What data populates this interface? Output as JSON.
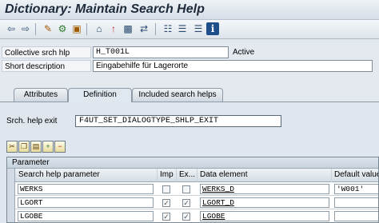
{
  "title": "Dictionary: Maintain Search Help",
  "toolbar": {
    "icons": [
      "back-icon",
      "forward-icon",
      "edit-icon",
      "activate-icon",
      "object-list-icon",
      "where-used-icon",
      "check-icon",
      "navigate-icon",
      "hierarchy-icon",
      "display-icon",
      "list-icon",
      "info-icon"
    ],
    "glyphs": [
      "⇦",
      "⇨",
      "✎",
      "⚙",
      "▣",
      "⌂",
      "↑",
      "▩",
      "⇄",
      "☷",
      "☰",
      "i"
    ]
  },
  "header": {
    "collective_label": "Collective srch hlp",
    "collective_value": "H_T001L",
    "status": "Active",
    "short_desc_label": "Short description",
    "short_desc_value": "Eingabehilfe für Lagerorte"
  },
  "tabs": [
    "Attributes",
    "Definition",
    "Included search helps"
  ],
  "active_tab": "Definition",
  "definition": {
    "exit_label": "Srch. help exit",
    "exit_value": "F4UT_SET_DIALOGTYPE_SHLP_EXIT"
  },
  "grid_buttons": [
    "cut-icon",
    "copy-icon",
    "paste-icon",
    "insert-row-icon",
    "delete-row-icon"
  ],
  "grid": {
    "title": "Parameter",
    "columns": [
      "Search help parameter",
      "Imp",
      "Ex...",
      "Data element",
      "Default value"
    ],
    "rows": [
      {
        "param": "WERKS",
        "imp": false,
        "exp": false,
        "data_element": "WERKS_D",
        "default": "'W001'"
      },
      {
        "param": "LGORT",
        "imp": true,
        "exp": true,
        "data_element": "LGORT_D",
        "default": ""
      },
      {
        "param": "LGOBE",
        "imp": true,
        "exp": true,
        "data_element": "LGOBE",
        "default": ""
      }
    ]
  },
  "colors": {
    "title_text": "#1c2a3a",
    "panel": "#dfe6ed",
    "accent": "#2b4a6f"
  }
}
